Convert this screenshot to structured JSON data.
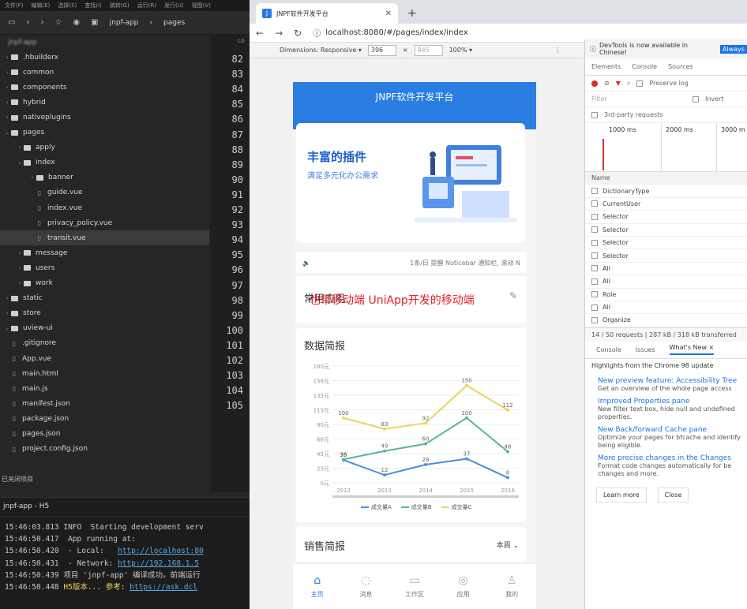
{
  "ide": {
    "menu": [
      "文件(F)",
      "编辑(E)",
      "选择(S)",
      "查找(I)",
      "跳转(G)",
      "运行(R)",
      "发行(U)",
      "视图(V)"
    ],
    "crumbs": [
      "jnpf-app",
      "pages"
    ],
    "root": "jnpf-app",
    "tree": [
      {
        "depth": 0,
        "type": "folder",
        "open": false,
        "label": ".hbuilderx"
      },
      {
        "depth": 0,
        "type": "folder",
        "open": false,
        "label": "common"
      },
      {
        "depth": 0,
        "type": "folder",
        "open": false,
        "label": "components"
      },
      {
        "depth": 0,
        "type": "folder",
        "open": false,
        "label": "hybrid"
      },
      {
        "depth": 0,
        "type": "folder",
        "open": false,
        "label": "nativeplugins"
      },
      {
        "depth": 0,
        "type": "folder",
        "open": true,
        "label": "pages"
      },
      {
        "depth": 1,
        "type": "folder",
        "open": false,
        "label": "apply"
      },
      {
        "depth": 1,
        "type": "folder",
        "open": true,
        "label": "index"
      },
      {
        "depth": 2,
        "type": "folder",
        "open": false,
        "label": "banner"
      },
      {
        "depth": 2,
        "type": "file",
        "label": "guide.vue"
      },
      {
        "depth": 2,
        "type": "file",
        "label": "index.vue"
      },
      {
        "depth": 2,
        "type": "file",
        "label": "privacy_policy.vue"
      },
      {
        "depth": 2,
        "type": "file",
        "label": "transit.vue",
        "selected": true
      },
      {
        "depth": 1,
        "type": "folder",
        "open": false,
        "label": "message"
      },
      {
        "depth": 1,
        "type": "folder",
        "open": false,
        "label": "users"
      },
      {
        "depth": 1,
        "type": "folder",
        "open": false,
        "label": "work"
      },
      {
        "depth": 0,
        "type": "folder",
        "open": false,
        "label": "static"
      },
      {
        "depth": 0,
        "type": "folder",
        "open": false,
        "label": "store"
      },
      {
        "depth": 0,
        "type": "folder",
        "open": true,
        "label": "uview-ui"
      },
      {
        "depth": 0,
        "type": "file",
        "label": ".gitignore"
      },
      {
        "depth": 0,
        "type": "file",
        "label": "App.vue"
      },
      {
        "depth": 0,
        "type": "file",
        "label": "main.html"
      },
      {
        "depth": 0,
        "type": "file",
        "label": "main.js"
      },
      {
        "depth": 0,
        "type": "file",
        "label": "manifest.json"
      },
      {
        "depth": 0,
        "type": "file",
        "label": "package.json"
      },
      {
        "depth": 0,
        "type": "file",
        "label": "pages.json"
      },
      {
        "depth": 0,
        "type": "file",
        "label": "project.config.json"
      }
    ],
    "line_numbers": [
      "82",
      "83",
      "84",
      "85",
      "86",
      "87",
      "88",
      "89",
      "90",
      "91",
      "92",
      "93",
      "94",
      "95",
      "96",
      "97",
      "98",
      "99",
      "100",
      "101",
      "102",
      "103",
      "104",
      "105"
    ],
    "gutter_label": "co",
    "closed_projects": "已关闭项目",
    "terminal_title": "jnpf-app - H5",
    "terminal": [
      {
        "time": "15:46:03.813",
        "text": " INFO  Starting development serv"
      },
      {
        "time": "15:46:50.417",
        "text": "  App running at:"
      },
      {
        "time": "15:46:50.420",
        "text": "  - Local:   ",
        "link": "http://localhost:80"
      },
      {
        "time": "15:46:50.431",
        "text": "  - Network: ",
        "link": "http://192.168.1.5"
      },
      {
        "time": "15:46:50.439",
        "text": " 项目 'jnpf-app' 编译成功。前端运行"
      },
      {
        "time": "15:46:50.448",
        "text": " ",
        "warn": "H5版本... 参考: ",
        "link": "https://ask.dcl"
      }
    ]
  },
  "browser": {
    "tab_title": "JNPF软件开发平台",
    "url": "localhost:8080/#/pages/index/index",
    "dimensions": "Dimensions: Responsive ▾",
    "width": "396",
    "height": "845",
    "zoom": "100% ▾"
  },
  "app": {
    "header_title": "JNPF软件开发平台",
    "banner_title": "丰富的插件",
    "banner_sub": "满足多元化办公需求",
    "notice_text": "1条/日 提醒 Noticebar 通知栏, 滚动 N",
    "common_apps": "常用应用",
    "overlay_caption": "也带移动端  UniApp开发的移动端",
    "data_brief": "数据简报",
    "sales_brief": "销售简报",
    "sales_period": "本周 ⌄",
    "nav": [
      {
        "label": "主页",
        "icon": "home-icon",
        "active": true
      },
      {
        "label": "消息",
        "icon": "message-icon",
        "active": false
      },
      {
        "label": "工作区",
        "icon": "workspace-icon",
        "active": false
      },
      {
        "label": "应用",
        "icon": "apps-icon",
        "active": false
      },
      {
        "label": "我的",
        "icon": "user-icon",
        "active": false
      }
    ]
  },
  "chart_data": {
    "type": "line",
    "title": "数据简报",
    "categories": [
      "2012",
      "2013",
      "2014",
      "2015",
      "2016"
    ],
    "yticks": [
      "0元",
      "23元",
      "45元",
      "68元",
      "90元",
      "113元",
      "135元",
      "158元",
      "180元"
    ],
    "ylim": [
      0,
      180
    ],
    "series": [
      {
        "name": "成交量A",
        "color": "#4a90d9",
        "values": [
          35,
          12,
          28,
          37,
          8
        ]
      },
      {
        "name": "成交量B",
        "color": "#5bb5a0",
        "values": [
          36,
          49,
          60,
          100,
          48
        ]
      },
      {
        "name": "成交量C",
        "color": "#e8d65a",
        "values": [
          100,
          83,
          92,
          150,
          112
        ]
      }
    ]
  },
  "devtools": {
    "info": "DevTools is now available in Chinese!",
    "always": "Always",
    "tabs": [
      "Elements",
      "Console",
      "Sources"
    ],
    "preserve_log": "Preserve log",
    "filter": "Filter",
    "invert": "Invert",
    "third_party": "3rd-party requests",
    "timeline": [
      "1000 ms",
      "2000 ms",
      "3000 m"
    ],
    "name_header": "Name",
    "requests": [
      "DictionaryType",
      "CurrentUser",
      "Selector",
      "Selector",
      "Selector",
      "Selector",
      "All",
      "All",
      "Role",
      "All",
      "Organize"
    ],
    "status": "14 / 50 requests  |  287 kB / 318 kB transferred",
    "drawer_tabs": [
      "Console",
      "Issues",
      "What's New ×"
    ],
    "highlights": "Highlights from the Chrome 98 update",
    "features": [
      {
        "title": "New preview feature: Accessibility Tree",
        "desc": "Get an overview of the whole page access"
      },
      {
        "title": "Improved Properties pane",
        "desc": "New filter text box, hide null and undefined properties."
      },
      {
        "title": "New Back/forward Cache pane",
        "desc": "Optimize your pages for bfcache and identify being eligible."
      },
      {
        "title": "More precise changes in the Changes",
        "desc": "Format code changes automatically for be changes and more."
      }
    ],
    "learn_more": "Learn more",
    "close": "Close"
  }
}
